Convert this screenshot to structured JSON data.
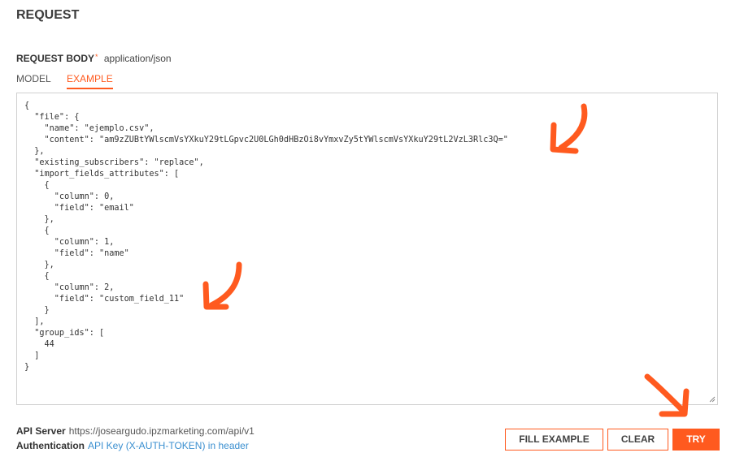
{
  "section_title": "REQUEST",
  "request_body": {
    "label": "REQUEST BODY",
    "required_marker": "*",
    "content_type": "application/json"
  },
  "tabs": [
    {
      "label": "MODEL",
      "active": false
    },
    {
      "label": "EXAMPLE",
      "active": true
    }
  ],
  "editor": {
    "content": "{\n  \"file\": {\n    \"name\": \"ejemplo.csv\",\n    \"content\": \"am9zZUBtYWlscmVsYXkuY29tLGpvc2U0LGh0dHBzOi8vYmxvZy5tYWlscmVsYXkuY29tL2VzL3Rlc3Q=\"\n  },\n  \"existing_subscribers\": \"replace\",\n  \"import_fields_attributes\": [\n    {\n      \"column\": 0,\n      \"field\": \"email\"\n    },\n    {\n      \"column\": 1,\n      \"field\": \"name\"\n    },\n    {\n      \"column\": 2,\n      \"field\": \"custom_field_11\"\n    }\n  ],\n  \"group_ids\": [\n    44\n  ]\n}"
  },
  "footer": {
    "api_server_label": "API Server",
    "api_server_value": "https://joseargudo.ipzmarketing.com/api/v1",
    "auth_label": "Authentication",
    "auth_value": "API Key (X-AUTH-TOKEN) in header"
  },
  "buttons": {
    "fill_example": "FILL EXAMPLE",
    "clear": "CLEAR",
    "try": "TRY"
  },
  "colors": {
    "accent": "#ff5a1f",
    "link": "#3a8fd0"
  },
  "annotations": [
    "arrow-icon",
    "arrow-icon",
    "arrow-icon"
  ]
}
